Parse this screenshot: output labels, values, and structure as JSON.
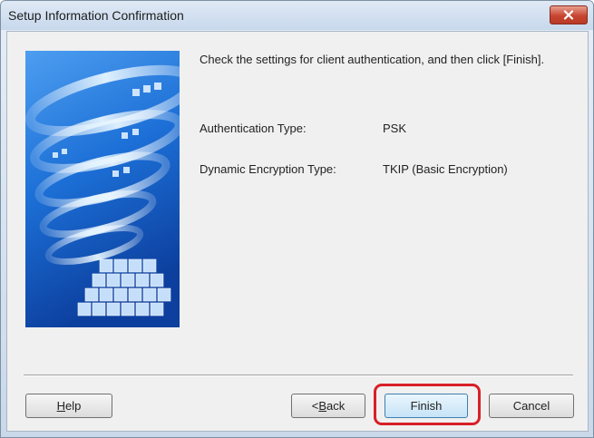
{
  "window": {
    "title": "Setup Information Confirmation"
  },
  "message": "Check the settings for client authentication, and then click [Finish].",
  "settings": [
    {
      "label": "Authentication Type:",
      "value": "PSK"
    },
    {
      "label": "Dynamic Encryption Type:",
      "value": "TKIP (Basic Encryption)"
    }
  ],
  "buttons": {
    "help": {
      "mnemonic": "H",
      "rest": "elp"
    },
    "back": {
      "prefix": "<",
      "mnemonic": "B",
      "rest": "ack"
    },
    "finish": "Finish",
    "cancel": "Cancel"
  },
  "colors": {
    "highlight": "#d81f26",
    "banner_blue": "#1a63c9",
    "close_red": "#c74530"
  },
  "icons": [
    "close-icon"
  ]
}
